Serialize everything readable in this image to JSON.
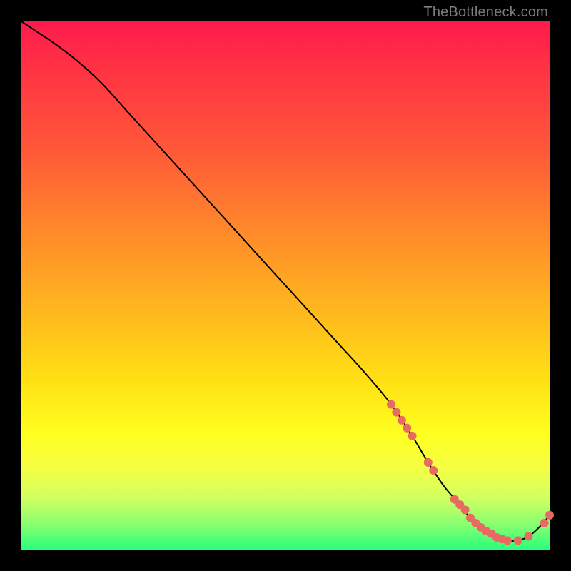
{
  "watermark": "TheBottleneck.com",
  "colors": {
    "frame_bg": "#000000",
    "gradient_top": "#ff1a4d",
    "gradient_mid": "#ffe014",
    "gradient_bottom": "#2aff7a",
    "curve": "#000000",
    "dot": "#e86a63"
  },
  "chart_data": {
    "type": "line",
    "title": "",
    "xlabel": "",
    "ylabel": "",
    "xlim": [
      0,
      100
    ],
    "ylim": [
      0,
      100
    ],
    "x": [
      0,
      3,
      6,
      10,
      15,
      20,
      25,
      30,
      35,
      40,
      45,
      50,
      55,
      60,
      65,
      70,
      74,
      77,
      80,
      83,
      85,
      88,
      90,
      92,
      94,
      96,
      98,
      100
    ],
    "y": [
      100,
      98,
      96,
      93,
      88.5,
      83,
      77.5,
      72,
      66.5,
      61,
      55.5,
      50,
      44.5,
      39,
      33.5,
      27.5,
      21.5,
      16.5,
      12,
      8.5,
      6,
      3.5,
      2.3,
      1.7,
      1.7,
      2.5,
      4.2,
      6.5
    ],
    "dots_x": [
      70,
      71,
      72,
      73,
      74,
      77,
      78,
      82,
      83,
      84,
      85,
      86,
      87,
      88,
      89,
      90,
      91,
      92,
      94,
      96,
      99,
      100
    ],
    "dots_y": [
      27.5,
      26,
      24.5,
      23,
      21.5,
      16.5,
      15,
      9.5,
      8.5,
      7.5,
      6,
      5,
      4.2,
      3.5,
      3,
      2.3,
      2,
      1.7,
      1.7,
      2.5,
      5,
      6.5
    ]
  }
}
